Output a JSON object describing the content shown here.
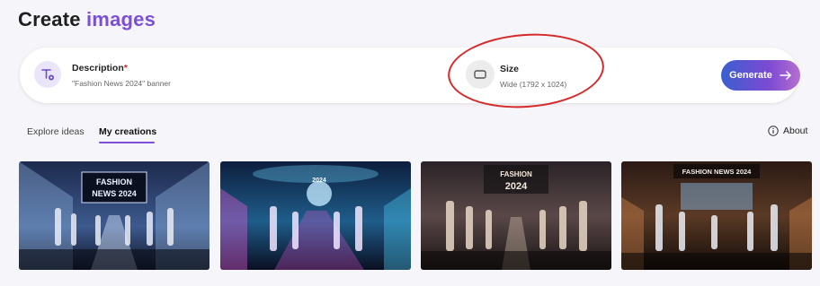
{
  "header": {
    "title_prefix": "Create",
    "title_accent": "images"
  },
  "prompt": {
    "description_label": "Description",
    "required_mark": "*",
    "description_value": "\"Fashion News 2024\" banner",
    "size_label": "Size",
    "size_value": "Wide (1792 x 1024)",
    "generate_label": "Generate"
  },
  "tabs": [
    {
      "label": "Explore ideas",
      "active": false
    },
    {
      "label": "My creations",
      "active": true
    }
  ],
  "about_label": "About",
  "gallery": [
    {
      "text": "FASHION\nNEWS 2024",
      "palette": [
        "#2a3a66",
        "#8fb3e0",
        "#d7e6ff"
      ]
    },
    {
      "text": "2024",
      "palette": [
        "#1b1f4a",
        "#4bc8f0",
        "#e75bd8"
      ]
    },
    {
      "text": "FASHION\n2024",
      "palette": [
        "#3b2a2c",
        "#c69a78",
        "#e6d3c0"
      ]
    },
    {
      "text": "FASHION NEWS 2024",
      "palette": [
        "#221a18",
        "#d98a4d",
        "#cde4ff"
      ]
    }
  ],
  "colors": {
    "accent": "#7b4fd6",
    "annotation": "#d62a2a"
  }
}
